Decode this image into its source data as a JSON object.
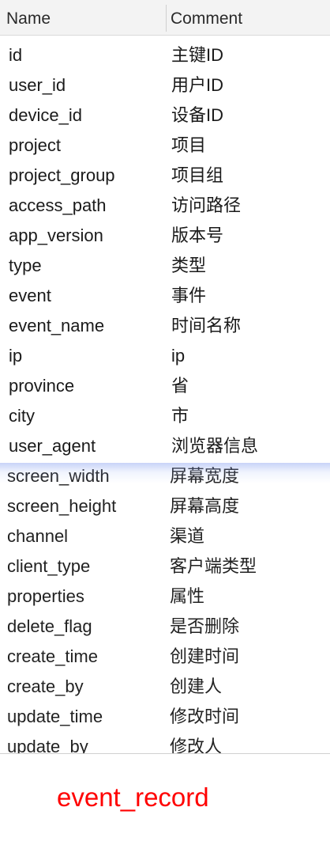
{
  "table": {
    "columns": {
      "name": "Name",
      "comment": "Comment"
    },
    "rows": [
      {
        "name": "id",
        "comment": "主键ID"
      },
      {
        "name": "user_id",
        "comment": "用户ID"
      },
      {
        "name": "device_id",
        "comment": "设备ID"
      },
      {
        "name": "project",
        "comment": "项目"
      },
      {
        "name": "project_group",
        "comment": "项目组"
      },
      {
        "name": "access_path",
        "comment": "访问路径"
      },
      {
        "name": "app_version",
        "comment": "版本号"
      },
      {
        "name": "type",
        "comment": "类型"
      },
      {
        "name": "event",
        "comment": "事件"
      },
      {
        "name": "event_name",
        "comment": "时间名称"
      },
      {
        "name": "ip",
        "comment": "ip"
      },
      {
        "name": "province",
        "comment": "省"
      },
      {
        "name": "city",
        "comment": "市"
      },
      {
        "name": "user_agent",
        "comment": "浏览器信息"
      },
      {
        "name": "screen_width",
        "comment": "屏幕宽度"
      },
      {
        "name": "screen_height",
        "comment": "屏幕高度"
      },
      {
        "name": "channel",
        "comment": "渠道"
      },
      {
        "name": "client_type",
        "comment": "客户端类型"
      },
      {
        "name": "properties",
        "comment": "属性"
      },
      {
        "name": "delete_flag",
        "comment": "是否删除"
      },
      {
        "name": "create_time",
        "comment": "创建时间"
      },
      {
        "name": "create_by",
        "comment": "创建人"
      },
      {
        "name": "update_time",
        "comment": "修改时间"
      },
      {
        "name": "update_by",
        "comment": "修改人"
      }
    ]
  },
  "caption": "event_record",
  "colors": {
    "caption": "#ff0000",
    "header_bg": "#f3f3f3"
  }
}
